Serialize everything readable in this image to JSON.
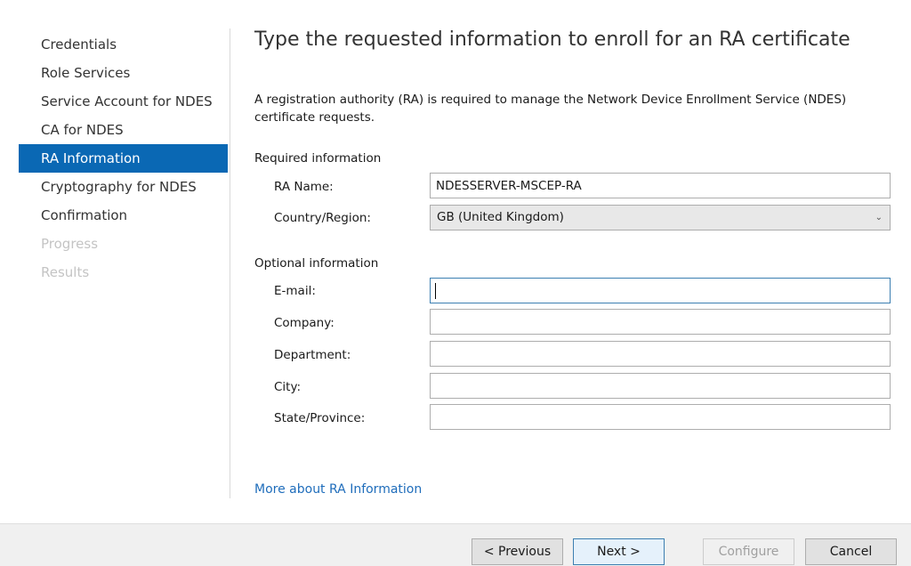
{
  "nav": {
    "items": [
      {
        "label": "Credentials",
        "state": "normal"
      },
      {
        "label": "Role Services",
        "state": "normal"
      },
      {
        "label": "Service Account for NDES",
        "state": "normal"
      },
      {
        "label": "CA for NDES",
        "state": "normal"
      },
      {
        "label": "RA Information",
        "state": "selected"
      },
      {
        "label": "Cryptography for NDES",
        "state": "normal"
      },
      {
        "label": "Confirmation",
        "state": "normal"
      },
      {
        "label": "Progress",
        "state": "disabled"
      },
      {
        "label": "Results",
        "state": "disabled"
      }
    ]
  },
  "page": {
    "title": "Type the requested information to enroll for an RA certificate",
    "description": "A registration authority (RA) is required to manage the Network Device Enrollment Service (NDES) certificate requests."
  },
  "required": {
    "section_label": "Required information",
    "ra_name_label": "RA Name:",
    "ra_name_value": "NDESSERVER-MSCEP-RA",
    "country_label": "Country/Region:",
    "country_value": "GB (United Kingdom)"
  },
  "optional": {
    "section_label": "Optional information",
    "email_label": "E-mail:",
    "email_value": "",
    "company_label": "Company:",
    "company_value": "",
    "department_label": "Department:",
    "department_value": "",
    "city_label": "City:",
    "city_value": "",
    "state_label": "State/Province:",
    "state_value": ""
  },
  "help_link": "More about RA Information",
  "footer": {
    "previous": "< Previous",
    "next": "Next >",
    "configure": "Configure",
    "cancel": "Cancel"
  },
  "colors": {
    "selected_nav": "#0a68b4",
    "link": "#1f6dbb",
    "disabled_text": "#c4c4c4"
  },
  "icons": {
    "dropdown": "chevron-down-icon"
  }
}
